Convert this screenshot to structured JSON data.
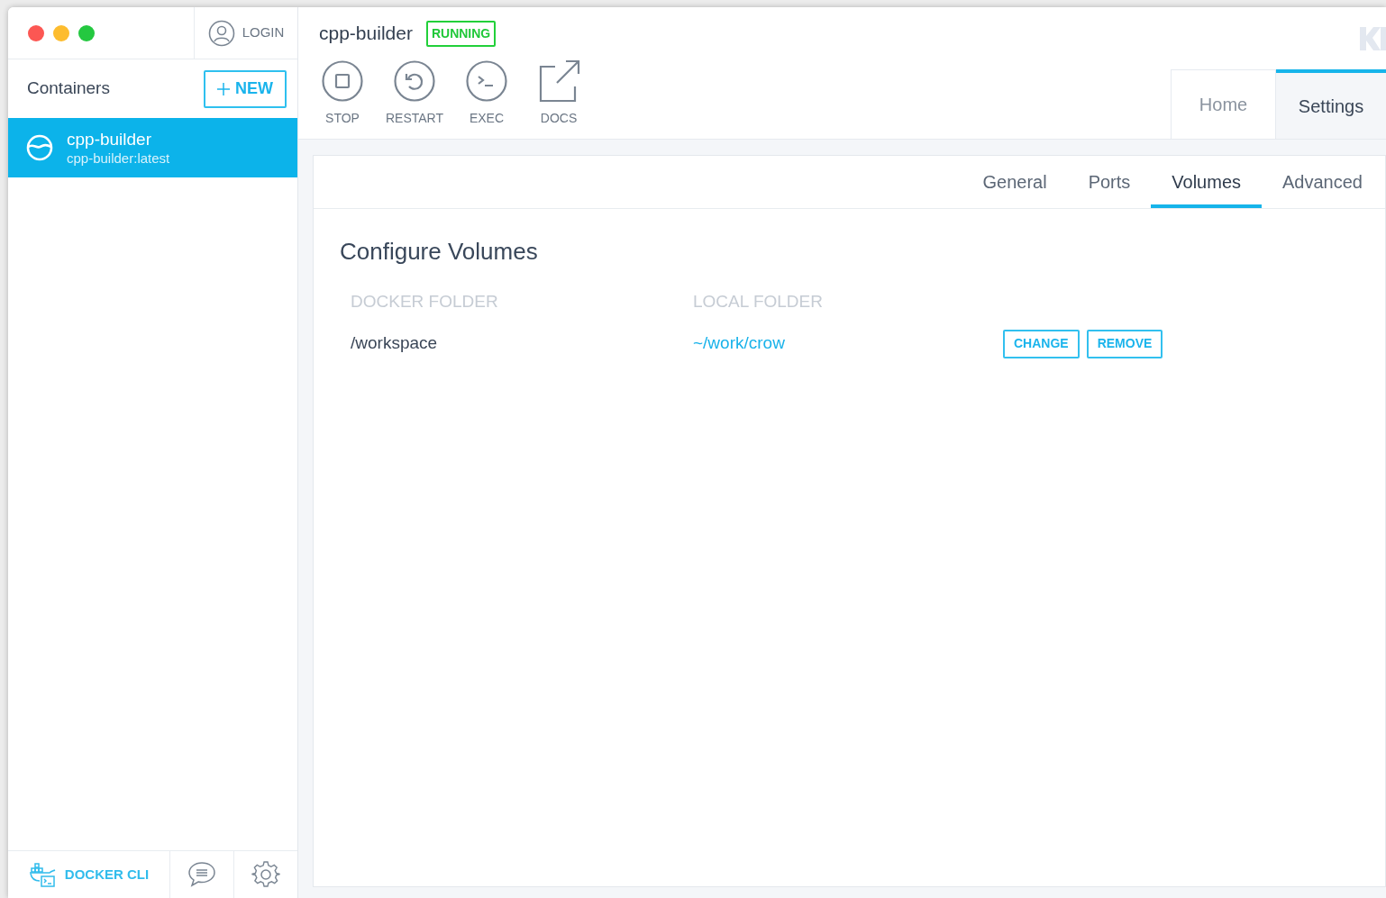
{
  "sidebar": {
    "login": "LOGIN",
    "heading": "Containers",
    "new_button": "NEW",
    "containers": [
      {
        "name": "cpp-builder",
        "image": "cpp-builder:latest",
        "selected": true
      }
    ],
    "footer": {
      "cli": "DOCKER CLI"
    }
  },
  "header": {
    "title": "cpp-builder",
    "status": "RUNNING",
    "actions": [
      {
        "kind": "stop",
        "label": "STOP"
      },
      {
        "kind": "restart",
        "label": "RESTART"
      },
      {
        "kind": "exec",
        "label": "EXEC"
      },
      {
        "kind": "docs",
        "label": "DOCS"
      }
    ],
    "tabs": [
      {
        "label": "Home",
        "selected": false
      },
      {
        "label": "Settings",
        "selected": true
      }
    ]
  },
  "settings": {
    "tabs": [
      {
        "label": "General",
        "selected": false
      },
      {
        "label": "Ports",
        "selected": false
      },
      {
        "label": "Volumes",
        "selected": true
      },
      {
        "label": "Advanced",
        "selected": false
      }
    ],
    "title": "Configure Volumes",
    "columns": [
      "DOCKER FOLDER",
      "LOCAL FOLDER"
    ],
    "rows": [
      {
        "docker_folder": "/workspace",
        "local_folder": "~/work/crow",
        "actions": [
          "CHANGE",
          "REMOVE"
        ]
      }
    ]
  }
}
